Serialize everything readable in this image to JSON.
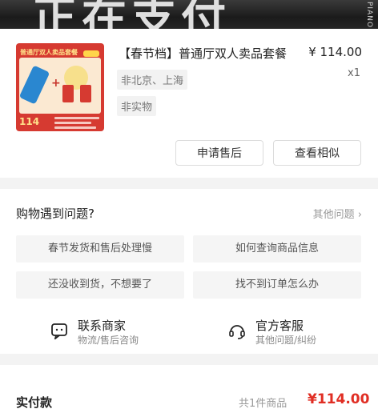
{
  "banner": {
    "big_text": "正在支付",
    "side_text": "PIANO"
  },
  "order_item": {
    "thumbnail": {
      "title": "普通厅双人卖品套餐",
      "price_badge": "114"
    },
    "title": "【春节档】普通厅双人卖品套餐",
    "price": "¥ 114.00",
    "quantity": "x1",
    "tags": [
      "非北京、上海",
      "非实物"
    ],
    "actions": {
      "after_sale": "申请售后",
      "view_similar": "查看相似"
    }
  },
  "faq": {
    "title": "购物遇到问题?",
    "more": "其他问题 ›",
    "questions": [
      "春节发货和售后处理慢",
      "如何查询商品信息",
      "还没收到货，不想要了",
      "找不到订单怎么办"
    ],
    "contact_merchant": {
      "label": "联系商家",
      "sub": "物流/售后咨询",
      "icon": "chat-icon"
    },
    "official_service": {
      "label": "官方客服",
      "sub": "其他问题/纠纷",
      "icon": "headset-icon"
    }
  },
  "payment": {
    "label": "实付款",
    "count": "共1件商品",
    "total": "¥114.00"
  },
  "colors": {
    "accent": "#e02e24",
    "thumb_bg": "#d63a31"
  }
}
